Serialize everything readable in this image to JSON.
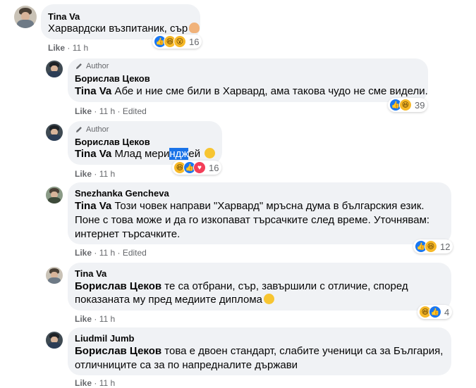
{
  "comments": [
    {
      "name": "Tina Va",
      "text": "Харвардски възпитаник, сър",
      "meta": {
        "like": "Like",
        "time": "11 h"
      },
      "reactions": {
        "count": "16"
      }
    },
    {
      "author_badge": "Author",
      "name": "Борислав Цеков",
      "mention": "Tina Va",
      "text": "Абе и ние сме били в Харвард, ама такова чудо не сме видели.",
      "meta": {
        "like": "Like",
        "time": "11 h",
        "edited": "Edited"
      },
      "reactions": {
        "count": "39"
      }
    },
    {
      "author_badge": "Author",
      "name": "Борислав Цеков",
      "mention": "Tina Va",
      "text_before": "Млад мери",
      "text_highlight": "ндж",
      "text_after": "ей",
      "meta": {
        "like": "Like",
        "time": "11 h"
      },
      "reactions": {
        "count": "16"
      }
    },
    {
      "name": "Snezhanka Gencheva",
      "mention": "Tina Va",
      "line1": "Този човек направи \"Харвард\" мръсна дума в българския език.",
      "line2": "Поне с това може и да го изкопават търсачките след време. Уточнявам:",
      "line3": "интернет търсачките.",
      "meta": {
        "like": "Like",
        "time": "11 h",
        "edited": "Edited"
      },
      "reactions": {
        "count": "12"
      }
    },
    {
      "name": "Tina Va",
      "mention": "Борислав Цеков",
      "line1": "те са отбрани, сър, завършили с отличие, според",
      "line2": "показаната му пред медиите диплома",
      "meta": {
        "like": "Like",
        "time": "11 h"
      },
      "reactions": {
        "count": "4"
      }
    },
    {
      "name": "Liudmil Jumb",
      "mention": "Борислав Цеков",
      "line1": "това е двоен стандарт, слабите ученици са за България,",
      "line2": "отличниците са за по напредналите държави",
      "meta": {
        "like": "Like",
        "time": "11 h"
      }
    }
  ]
}
